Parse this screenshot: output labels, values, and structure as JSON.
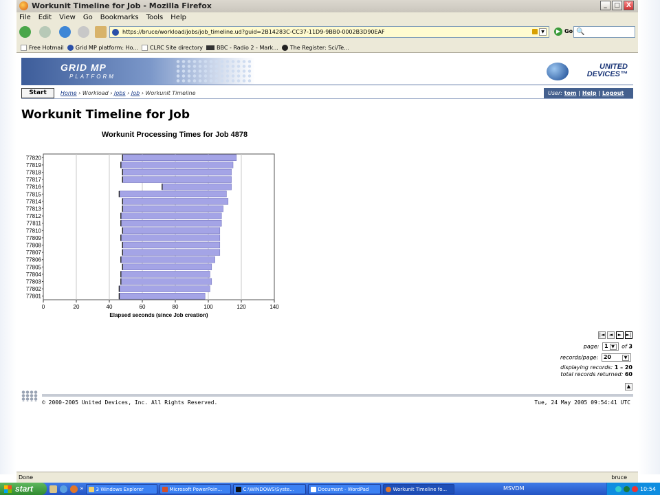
{
  "window": {
    "title": "Workunit Timeline for Job - Mozilla Firefox",
    "minimize": "_",
    "maximize": "□",
    "close": "X"
  },
  "menu": [
    "File",
    "Edit",
    "View",
    "Go",
    "Bookmarks",
    "Tools",
    "Help"
  ],
  "nav": {
    "url": "https://bruce/workload/jobs/job_timeline.ud?guid=2B14283C-CC37-11D9-9BB0-0002B3D90EAF",
    "go_label": "Go"
  },
  "bookmarks": [
    "Free Hotmail",
    "Grid MP platform: Ho...",
    "CLRC Site directory",
    "BBC - Radio 2 - Mark...",
    "The Register: Sci/Te..."
  ],
  "banner": {
    "logo_title": "GRID MP",
    "logo_subtitle": "PLATFORM",
    "brand_line1": "UNITED",
    "brand_line2": "DEVICES™"
  },
  "crumb": {
    "start": "Start",
    "items": [
      "Home",
      "Workload",
      "Jobs",
      "Job",
      "Workunit Timeline"
    ],
    "user_label": "User:",
    "user": "tom",
    "help": "Help",
    "logout": "Logout"
  },
  "page": {
    "title": "Workunit Timeline for Job"
  },
  "chart_data": {
    "type": "bar",
    "orientation": "horizontal",
    "subtype": "floating-range",
    "title": "Workunit Processing Times for Job 4878",
    "xlabel": "Elapsed seconds (since Job creation)",
    "ylabel": "",
    "xlim": [
      0,
      140
    ],
    "xticks": [
      0,
      20,
      40,
      60,
      80,
      100,
      120,
      140
    ],
    "grid": "vertical",
    "bar_color": "#a4a4e6",
    "categories": [
      "77820",
      "77819",
      "77818",
      "77817",
      "77816",
      "77815",
      "77814",
      "77813",
      "77812",
      "77811",
      "77810",
      "77809",
      "77808",
      "77807",
      "77806",
      "77805",
      "77804",
      "77803",
      "77802",
      "77801"
    ],
    "start": [
      48,
      47,
      48,
      48,
      72,
      46,
      48,
      48,
      47,
      47,
      48,
      47,
      48,
      48,
      47,
      48,
      47,
      47,
      46,
      46
    ],
    "end": [
      117,
      115,
      114,
      114,
      114,
      111,
      112,
      109,
      108,
      108,
      107,
      107,
      107,
      107,
      104,
      102,
      101,
      102,
      101,
      98
    ]
  },
  "pager": {
    "first": "|◄",
    "prev": "◄",
    "next": "►",
    "last": "►|",
    "page_label": "page:",
    "page_value": "1",
    "page_of": "of",
    "page_total": "3",
    "rpp_label": "records/page:",
    "rpp_value": "20",
    "displaying_label": "displaying records:",
    "displaying_value": "1 – 20",
    "total_label": "total records returned:",
    "total_value": "60",
    "top": "▲"
  },
  "footer": {
    "copyright": "© 2000-2005 United Devices, Inc. All Rights Reserved.",
    "timestamp": "Tue, 24 May 2005 09:54:41 UTC"
  },
  "status": {
    "left": "Done",
    "right": "bruce"
  },
  "taskbar": {
    "start": "start",
    "items": [
      "3 Windows Explorer",
      "Microsoft PowerPoin...",
      "C:\\WINDOWS\\Syste...",
      "Document - WordPad",
      "Workunit Timeline fo..."
    ],
    "msvdm": "MSVDM",
    "clock": "10:54"
  }
}
